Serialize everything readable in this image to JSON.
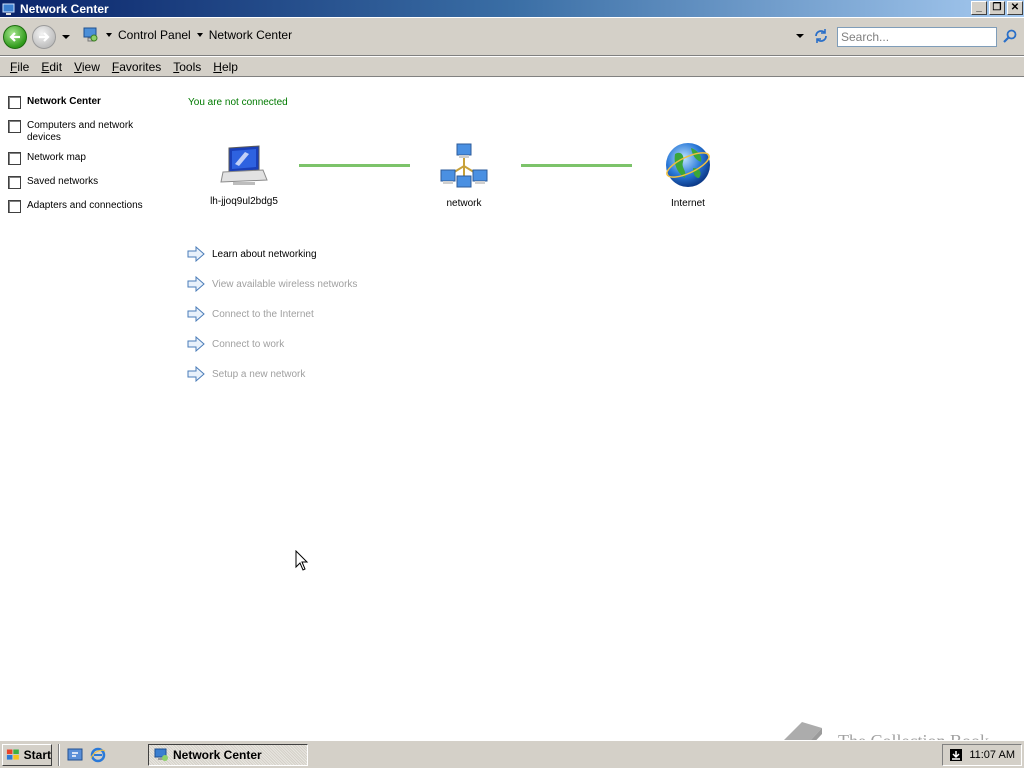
{
  "window": {
    "title": "Network Center",
    "minimize_label": "_",
    "restore_label": "❐",
    "close_label": "✕"
  },
  "address": {
    "crumbs": [
      "Control Panel",
      "Network Center"
    ],
    "search_placeholder": "Search..."
  },
  "menu": {
    "items": [
      {
        "key": "F",
        "rest": "ile"
      },
      {
        "key": "E",
        "rest": "dit"
      },
      {
        "key": "V",
        "rest": "iew"
      },
      {
        "key": "F",
        "rest": "avorites",
        "pre": ""
      },
      {
        "key": "T",
        "rest": "ools"
      },
      {
        "key": "H",
        "rest": "elp"
      }
    ]
  },
  "sidebar": {
    "items": [
      {
        "label": "Network Center"
      },
      {
        "label": "Computers and network devices"
      },
      {
        "label": "Network map"
      },
      {
        "label": "Saved networks"
      },
      {
        "label": "Adapters and connections"
      }
    ]
  },
  "main": {
    "status": "You are not connected",
    "nodes": [
      {
        "label": "lh-jjoq9ul2bdg5",
        "icon": "computer-icon"
      },
      {
        "label": "network",
        "icon": "network-icon"
      },
      {
        "label": "Internet",
        "icon": "internet-globe-icon"
      }
    ],
    "tasks": [
      {
        "label": "Learn about networking",
        "enabled": true
      },
      {
        "label": "View available wireless networks",
        "enabled": false
      },
      {
        "label": "Connect to the Internet",
        "enabled": false
      },
      {
        "label": "Connect to work",
        "enabled": false
      },
      {
        "label": "Setup a new network",
        "enabled": false
      }
    ]
  },
  "taskbar": {
    "start_label": "Start",
    "active_window": "Network Center",
    "clock": "11:07 AM"
  },
  "watermark": "The Collection Book",
  "colors": {
    "status_green": "#007a00",
    "link_line": "#7cc36a",
    "disabled_text": "#a0a0a0"
  }
}
